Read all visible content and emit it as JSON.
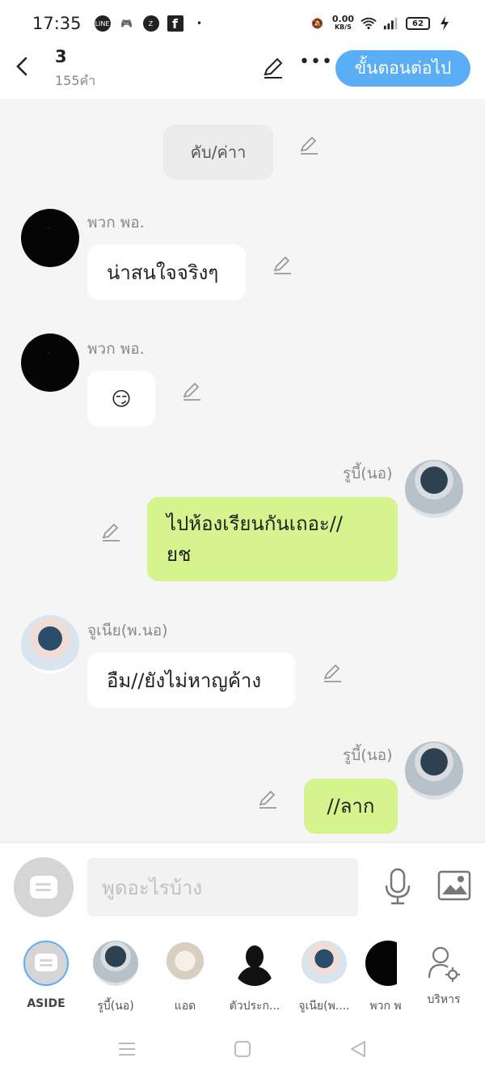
{
  "status_bar": {
    "time": "17:35",
    "net_speed": "0.00",
    "net_unit": "KB/S",
    "battery": "62"
  },
  "header": {
    "title": "3",
    "word_count": "155คำ",
    "next_button": "ขั้นตอนต่อไป"
  },
  "chat": {
    "narration": "คับ/ค่าา",
    "messages": [
      {
        "sender": "พวก พอ.",
        "text": "น่าสนใจจริงๆ",
        "side": "left"
      },
      {
        "sender": "พวก พอ.",
        "text": "😏",
        "side": "left"
      },
      {
        "sender": "รูบี้(นอ)",
        "text": "ไปห้องเรียนกันเถอะ//ยช",
        "line1": "ไปห้องเรียนกันเถอะ//",
        "line2": "ยช",
        "side": "right"
      },
      {
        "sender": "จูเนีย(พ.นอ)",
        "text": "อืม//ยังไม่หาญค้าง",
        "side": "left"
      },
      {
        "sender": "รูบี้(นอ)",
        "text": "//ลาก",
        "side": "right"
      }
    ]
  },
  "input": {
    "placeholder": "พูดอะไรบ้าง"
  },
  "characters": [
    {
      "label": "ASIDE"
    },
    {
      "label": "รูบี้(นอ)"
    },
    {
      "label": "แอด"
    },
    {
      "label": "ตัวประก..."
    },
    {
      "label": "จูเนีย(พ...."
    },
    {
      "label": "พวก พ"
    },
    {
      "label": "บริหาร"
    }
  ],
  "colors": {
    "accent": "#5aaef6",
    "bubble_right": "#d5f48e",
    "bubble_left": "#ffffff",
    "background": "#f5f5f5"
  }
}
